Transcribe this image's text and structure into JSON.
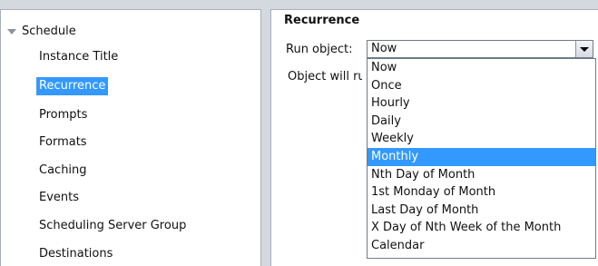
{
  "nav": {
    "root_label": "Schedule",
    "items": [
      {
        "label": "Instance Title",
        "selected": false
      },
      {
        "label": "Recurrence",
        "selected": true
      },
      {
        "label": "Prompts",
        "selected": false
      },
      {
        "label": "Formats",
        "selected": false
      },
      {
        "label": "Caching",
        "selected": false
      },
      {
        "label": "Events",
        "selected": false
      },
      {
        "label": "Scheduling Server Group",
        "selected": false
      },
      {
        "label": "Destinations",
        "selected": false
      }
    ]
  },
  "recurrence": {
    "title": "Recurrence",
    "run_label": "Run object:",
    "run_value": "Now",
    "will_label": "Object will ru",
    "options": [
      "Now",
      "Once",
      "Hourly",
      "Daily",
      "Weekly",
      "Monthly",
      "Nth Day of Month",
      "1st Monday of Month",
      "Last Day of Month",
      "X Day of Nth Week of the Month",
      "Calendar"
    ],
    "highlighted_option": "Monthly"
  },
  "colors": {
    "selection": "#3399ff",
    "background": "#d4d8df",
    "border": "#a8afba"
  },
  "icons": {
    "tree_expand": "triangle-down-icon",
    "dropdown": "chevron-down-icon"
  }
}
